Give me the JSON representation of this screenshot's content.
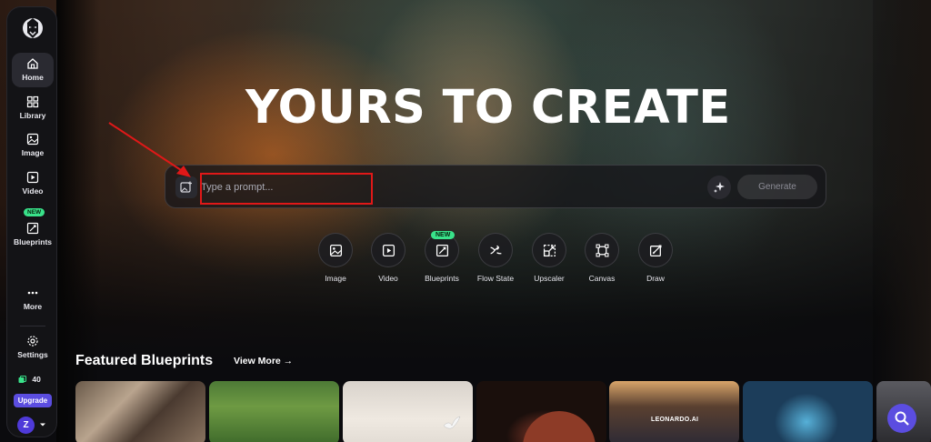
{
  "sidebar": {
    "items": [
      {
        "label": "Home",
        "icon": "home-icon",
        "active": true
      },
      {
        "label": "Library",
        "icon": "grid-icon"
      },
      {
        "label": "Image",
        "icon": "image-icon"
      },
      {
        "label": "Video",
        "icon": "video-icon"
      },
      {
        "label": "Blueprints",
        "icon": "blueprint-icon",
        "badge": "NEW"
      },
      {
        "label": "More",
        "icon": "more-icon"
      },
      {
        "label": "Settings",
        "icon": "gear-icon"
      }
    ],
    "credits": "40",
    "upgrade_label": "Upgrade",
    "avatar_initial": "Z"
  },
  "hero": {
    "headline": "YOURS TO CREATE",
    "prompt_placeholder": "Type a prompt...",
    "generate_label": "Generate"
  },
  "tools": [
    {
      "label": "Image",
      "icon": "image-icon"
    },
    {
      "label": "Video",
      "icon": "video-icon"
    },
    {
      "label": "Blueprints",
      "icon": "blueprint-icon",
      "badge": "NEW"
    },
    {
      "label": "Flow State",
      "icon": "flow-icon"
    },
    {
      "label": "Upscaler",
      "icon": "upscale-icon"
    },
    {
      "label": "Canvas",
      "icon": "canvas-icon"
    },
    {
      "label": "Draw",
      "icon": "draw-icon"
    }
  ],
  "featured": {
    "title": "Featured Blueprints",
    "view_more": "View More →",
    "card5_text": "LEONARDO.AI"
  },
  "colors": {
    "accent": "#5b4de0",
    "new_badge": "#39e28a",
    "annotation_red": "#e01818"
  }
}
